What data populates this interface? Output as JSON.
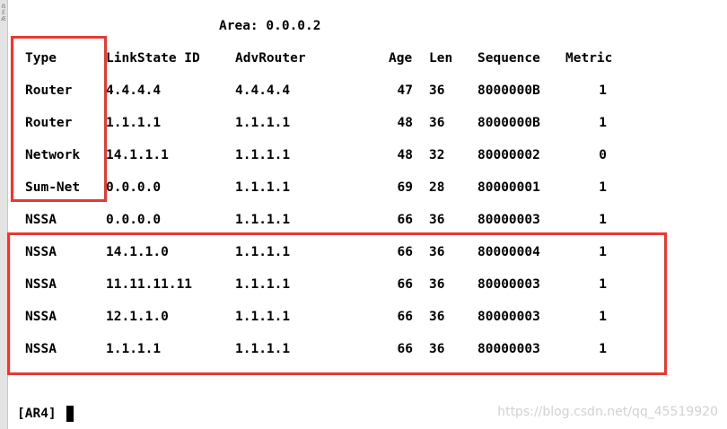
{
  "sidebar": {
    "label": "ẞÉÆ"
  },
  "area": {
    "label": "Area: 0.0.0.2"
  },
  "lsdb": {
    "headers": {
      "type": "Type",
      "link_state_id": "LinkState ID",
      "adv_router": "AdvRouter",
      "age": "Age",
      "len": "Len",
      "sequence": "Sequence",
      "metric": "Metric"
    },
    "rows": [
      {
        "type": "Router",
        "link_state_id": "4.4.4.4",
        "adv_router": "4.4.4.4",
        "age": "47",
        "len": "36",
        "sequence": "8000000B",
        "metric": "1"
      },
      {
        "type": "Router",
        "link_state_id": "1.1.1.1",
        "adv_router": "1.1.1.1",
        "age": "48",
        "len": "36",
        "sequence": "8000000B",
        "metric": "1"
      },
      {
        "type": "Network",
        "link_state_id": "14.1.1.1",
        "adv_router": "1.1.1.1",
        "age": "48",
        "len": "32",
        "sequence": "80000002",
        "metric": "0"
      },
      {
        "type": "Sum-Net",
        "link_state_id": "0.0.0.0",
        "adv_router": "1.1.1.1",
        "age": "69",
        "len": "28",
        "sequence": "80000001",
        "metric": "1"
      },
      {
        "type": "NSSA",
        "link_state_id": "0.0.0.0",
        "adv_router": "1.1.1.1",
        "age": "66",
        "len": "36",
        "sequence": "80000003",
        "metric": "1"
      },
      {
        "type": "NSSA",
        "link_state_id": "14.1.1.0",
        "adv_router": "1.1.1.1",
        "age": "66",
        "len": "36",
        "sequence": "80000004",
        "metric": "1"
      },
      {
        "type": "NSSA",
        "link_state_id": "11.11.11.11",
        "adv_router": "1.1.1.1",
        "age": "66",
        "len": "36",
        "sequence": "80000003",
        "metric": "1"
      },
      {
        "type": "NSSA",
        "link_state_id": "12.1.1.0",
        "adv_router": "1.1.1.1",
        "age": "66",
        "len": "36",
        "sequence": "80000003",
        "metric": "1"
      },
      {
        "type": "NSSA",
        "link_state_id": "1.1.1.1",
        "adv_router": "1.1.1.1",
        "age": "66",
        "len": "36",
        "sequence": "80000003",
        "metric": "1"
      }
    ]
  },
  "prompt": {
    "text": "[AR4]"
  },
  "watermark": {
    "text": "https://blog.csdn.net/qq_45519920"
  },
  "colors": {
    "highlight": "#e53935",
    "text": "#000000",
    "background": "#ffffff"
  }
}
